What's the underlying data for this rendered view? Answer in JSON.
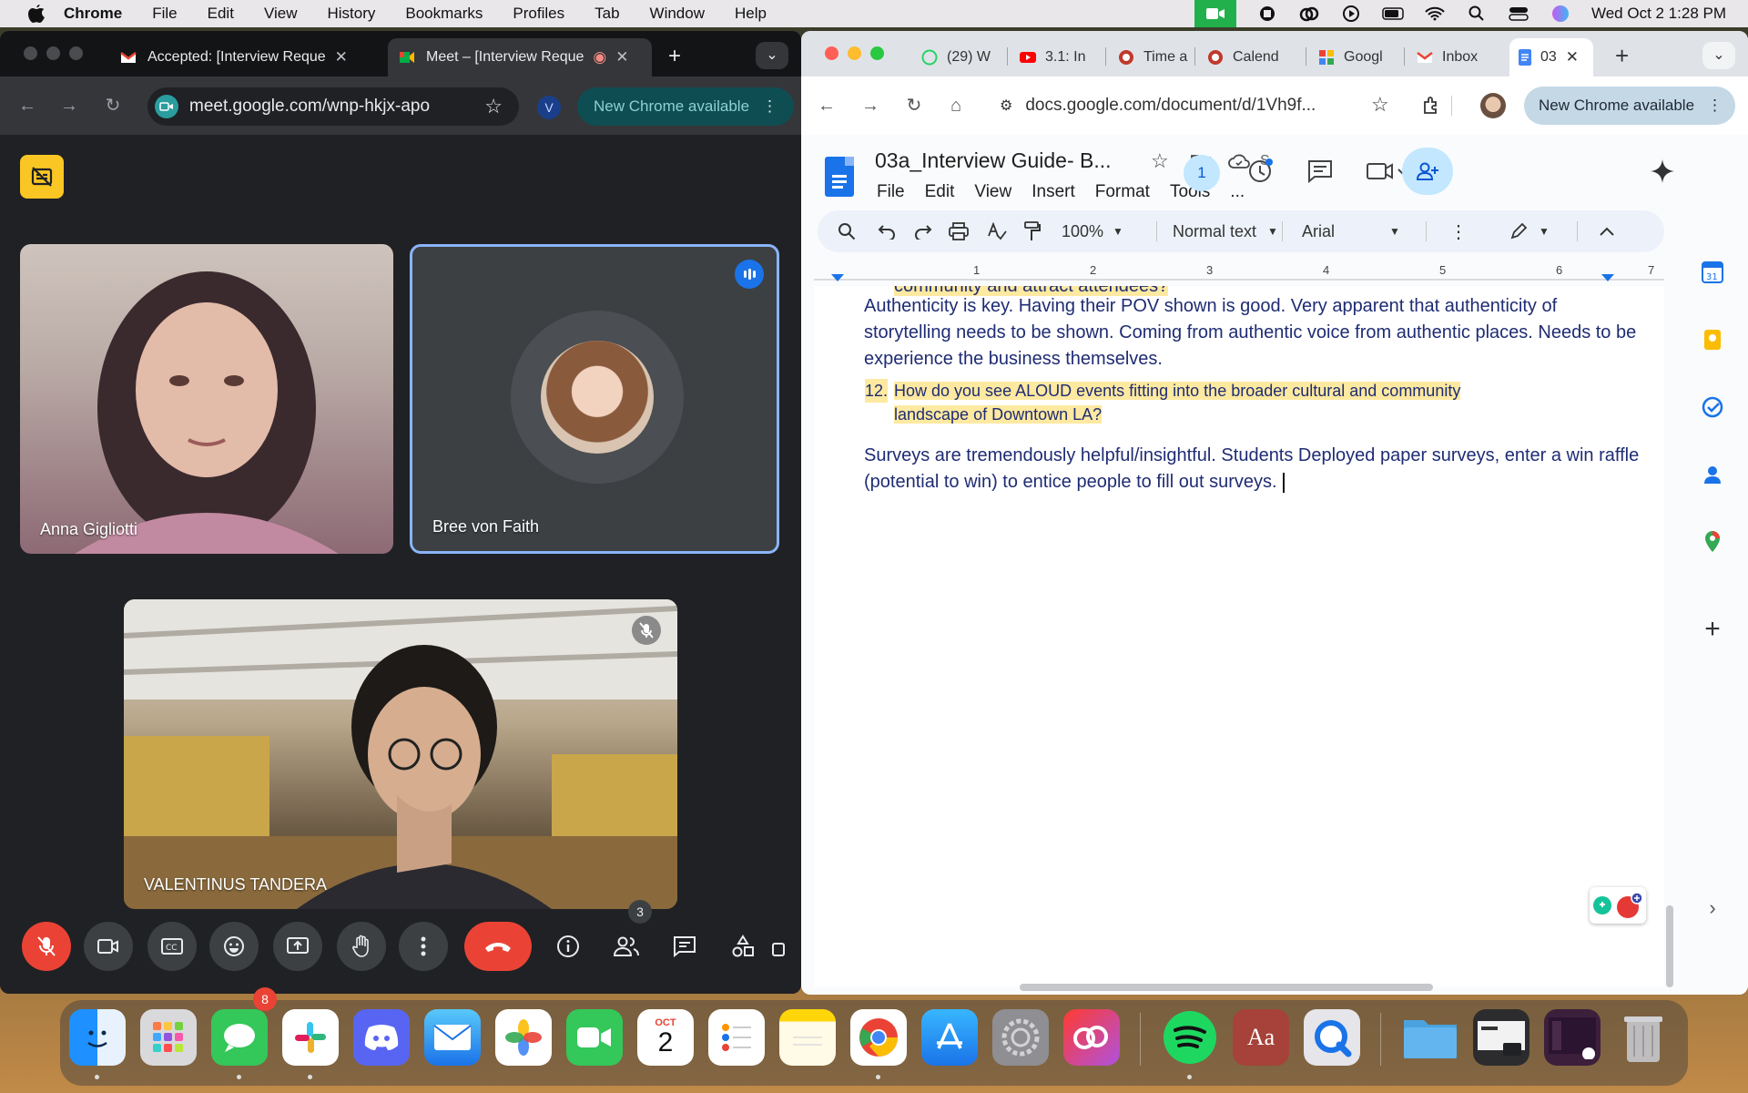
{
  "menubar": {
    "app_name": "Chrome",
    "items": [
      "File",
      "Edit",
      "View",
      "History",
      "Bookmarks",
      "Profiles",
      "Tab",
      "Window",
      "Help"
    ],
    "clock": "Wed Oct 2  1:28 PM"
  },
  "meet_window": {
    "tabs": [
      {
        "label": "Accepted: [Interview Reque"
      },
      {
        "label": "Meet – [Interview Reque"
      }
    ],
    "url": "meet.google.com/wnp-hkjx-apo",
    "profile_initial": "V",
    "update_label": "New Chrome available",
    "participants": [
      {
        "name": "Anna Gigliotti"
      },
      {
        "name": "Bree von Faith"
      },
      {
        "name": "VALENTINUS TANDERA"
      }
    ],
    "people_count": "3"
  },
  "docs_window": {
    "tabs": [
      {
        "label": "(29) W"
      },
      {
        "label": "3.1: In"
      },
      {
        "label": "Time a"
      },
      {
        "label": "Calend"
      },
      {
        "label": "Googl"
      },
      {
        "label": "Inbox"
      },
      {
        "label": "03"
      }
    ],
    "url": "docs.google.com/document/d/1Vh9f...",
    "update_label": "New Chrome available",
    "doc_title": "03a_Interview Guide- B...",
    "saved_letter": "S",
    "menu": [
      "File",
      "Edit",
      "View",
      "Insert",
      "Format",
      "Tools",
      "..."
    ],
    "viewer_count": "1",
    "toolbar": {
      "zoom": "100%",
      "style": "Normal text",
      "font": "Arial"
    },
    "ruler_marks": [
      "1",
      "2",
      "3",
      "4",
      "5",
      "6",
      "7"
    ],
    "content": {
      "cut_line": "community and attract attendees?",
      "para1": "Authenticity is key. Having their POV shown is good. Very apparent that authenticity of storytelling needs to be shown. Coming from authentic voice from authentic places. Needs to be experience the business themselves.",
      "question_num": "12.",
      "question_line1": "How do you see ALOUD events fitting into the broader cultural and community",
      "question_line2": "landscape of Downtown LA?",
      "para2": "Surveys are tremendously helpful/insightful. Students Deployed paper surveys, enter a win raffle (potential to win) to entice people to fill out surveys."
    },
    "side_calendar_day": "31"
  },
  "dock": {
    "messages_badge": "8",
    "calendar_month": "OCT",
    "calendar_day": "2",
    "dictionary_label": "Aa"
  }
}
